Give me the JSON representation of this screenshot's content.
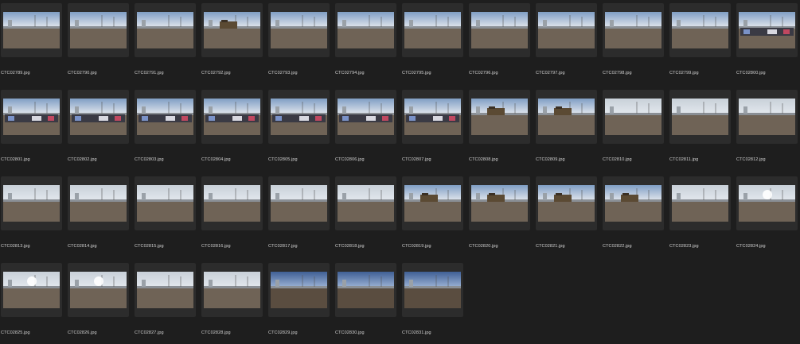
{
  "files": [
    {
      "name": "CTC02789.jpg",
      "scene": "plain"
    },
    {
      "name": "CTC02790.jpg",
      "scene": "plain"
    },
    {
      "name": "CTC02791.jpg",
      "scene": "plain"
    },
    {
      "name": "CTC02792.jpg",
      "scene": "train"
    },
    {
      "name": "CTC02793.jpg",
      "scene": "plain"
    },
    {
      "name": "CTC02794.jpg",
      "scene": "plain"
    },
    {
      "name": "CTC02795.jpg",
      "scene": "plain"
    },
    {
      "name": "CTC02796.jpg",
      "scene": "plain"
    },
    {
      "name": "CTC02797.jpg",
      "scene": "plain"
    },
    {
      "name": "CTC02798.jpg",
      "scene": "plain"
    },
    {
      "name": "CTC02799.jpg",
      "scene": "plain"
    },
    {
      "name": "CTC02800.jpg",
      "scene": "graffiti"
    },
    {
      "name": "CTC02801.jpg",
      "scene": "graffiti"
    },
    {
      "name": "CTC02802.jpg",
      "scene": "graffiti"
    },
    {
      "name": "CTC02803.jpg",
      "scene": "graffiti"
    },
    {
      "name": "CTC02804.jpg",
      "scene": "graffiti"
    },
    {
      "name": "CTC02805.jpg",
      "scene": "graffiti"
    },
    {
      "name": "CTC02806.jpg",
      "scene": "graffiti"
    },
    {
      "name": "CTC02807.jpg",
      "scene": "graffiti"
    },
    {
      "name": "CTC02808.jpg",
      "scene": "train"
    },
    {
      "name": "CTC02809.jpg",
      "scene": "train"
    },
    {
      "name": "CTC02810.jpg",
      "scene": "hazy"
    },
    {
      "name": "CTC02811.jpg",
      "scene": "hazy"
    },
    {
      "name": "CTC02812.jpg",
      "scene": "hazy"
    },
    {
      "name": "CTC02813.jpg",
      "scene": "hazy"
    },
    {
      "name": "CTC02814.jpg",
      "scene": "hazy"
    },
    {
      "name": "CTC02815.jpg",
      "scene": "hazy"
    },
    {
      "name": "CTC02816.jpg",
      "scene": "hazy"
    },
    {
      "name": "CTC02817.jpg",
      "scene": "hazy"
    },
    {
      "name": "CTC02818.jpg",
      "scene": "hazy"
    },
    {
      "name": "CTC02819.jpg",
      "scene": "train"
    },
    {
      "name": "CTC02820.jpg",
      "scene": "train"
    },
    {
      "name": "CTC02821.jpg",
      "scene": "train"
    },
    {
      "name": "CTC02822.jpg",
      "scene": "train"
    },
    {
      "name": "CTC02823.jpg",
      "scene": "hazy"
    },
    {
      "name": "CTC02824.jpg",
      "scene": "sun"
    },
    {
      "name": "CTC02825.jpg",
      "scene": "sun"
    },
    {
      "name": "CTC02826.jpg",
      "scene": "sun"
    },
    {
      "name": "CTC02827.jpg",
      "scene": "hazy"
    },
    {
      "name": "CTC02828.jpg",
      "scene": "hazy"
    },
    {
      "name": "CTC02829.jpg",
      "scene": "blue"
    },
    {
      "name": "CTC02830.jpg",
      "scene": "blue"
    },
    {
      "name": "CTC02831.jpg",
      "scene": "blue"
    }
  ],
  "colors": {
    "background": "#1e1e1e",
    "tile": "#2c2c2c",
    "filename_text": "#d2d2d2"
  }
}
